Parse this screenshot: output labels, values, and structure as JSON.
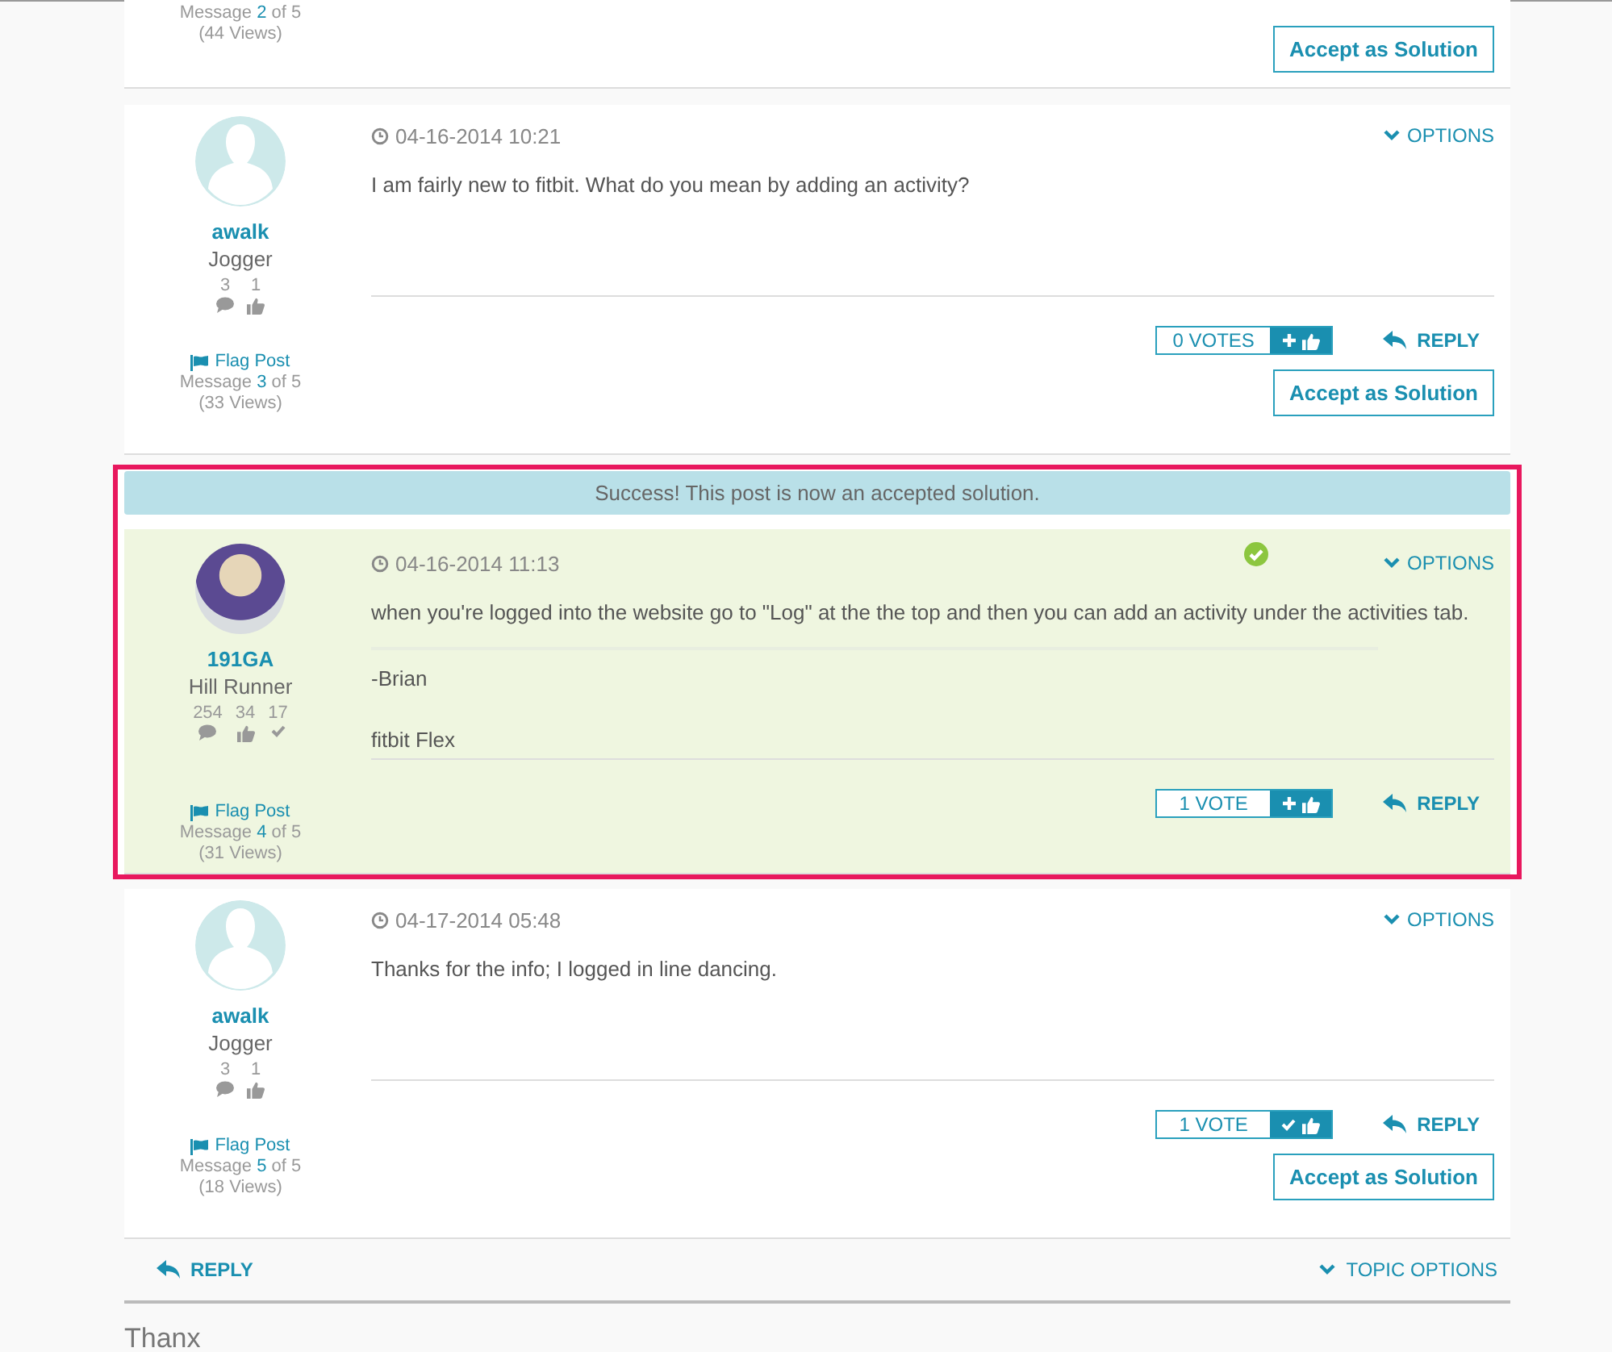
{
  "top_post": {
    "message_label": "Message",
    "message_number": "2",
    "message_total": "of 5",
    "views": "(44 Views)",
    "accept_label": "Accept as Solution"
  },
  "posts": [
    {
      "avatar": {
        "kind": "silhouette"
      },
      "author": "awalk",
      "rank": "Jogger",
      "stats": [
        {
          "kind": "posts",
          "value": "3"
        },
        {
          "kind": "kudos",
          "value": "1"
        }
      ],
      "flag_label": "Flag Post",
      "message_label": "Message",
      "message_number": "3",
      "message_total": "of 5",
      "views": "(33 Views)",
      "date": "04-16-2014 10:21",
      "options_label": "OPTIONS",
      "accepted": false,
      "body": [
        "I am fairly new to fitbit. What do you mean by adding an activity?"
      ],
      "votes": {
        "label": "0 VOTES",
        "voted": false
      },
      "reply_label": "REPLY",
      "accept_label": "Accept as Solution"
    },
    {
      "success_banner": "Success! This post is now an accepted solution.",
      "avatar": {
        "kind": "photo"
      },
      "author": "191GA",
      "rank": "Hill Runner",
      "stats": [
        {
          "kind": "posts",
          "value": "254"
        },
        {
          "kind": "kudos",
          "value": "34"
        },
        {
          "kind": "solutions",
          "value": "17"
        }
      ],
      "flag_label": "Flag Post",
      "message_label": "Message",
      "message_number": "4",
      "message_total": "of 5",
      "views": "(31 Views)",
      "date": "04-16-2014 11:13",
      "options_label": "OPTIONS",
      "accepted": true,
      "body": [
        "when you're logged into the website go to \"Log\" at the the top and then you can add an activity under the activities tab."
      ],
      "signature": [
        "-Brian",
        "fitbit Flex"
      ],
      "votes": {
        "label": "1 VOTE",
        "voted": false
      },
      "reply_label": "REPLY"
    },
    {
      "avatar": {
        "kind": "silhouette"
      },
      "author": "awalk",
      "rank": "Jogger",
      "stats": [
        {
          "kind": "posts",
          "value": "3"
        },
        {
          "kind": "kudos",
          "value": "1"
        }
      ],
      "flag_label": "Flag Post",
      "message_label": "Message",
      "message_number": "5",
      "message_total": "of 5",
      "views": "(18 Views)",
      "date": "04-17-2014 05:48",
      "options_label": "OPTIONS",
      "accepted": false,
      "body": [
        "Thanks for the info; I logged in line dancing."
      ],
      "votes": {
        "label": "1 VOTE",
        "voted": true
      },
      "reply_label": "REPLY",
      "accept_label": "Accept as Solution"
    }
  ],
  "footer": {
    "reply_label": "REPLY",
    "topic_options_label": "TOPIC OPTIONS"
  },
  "next_section": {
    "title": "Thanx"
  }
}
